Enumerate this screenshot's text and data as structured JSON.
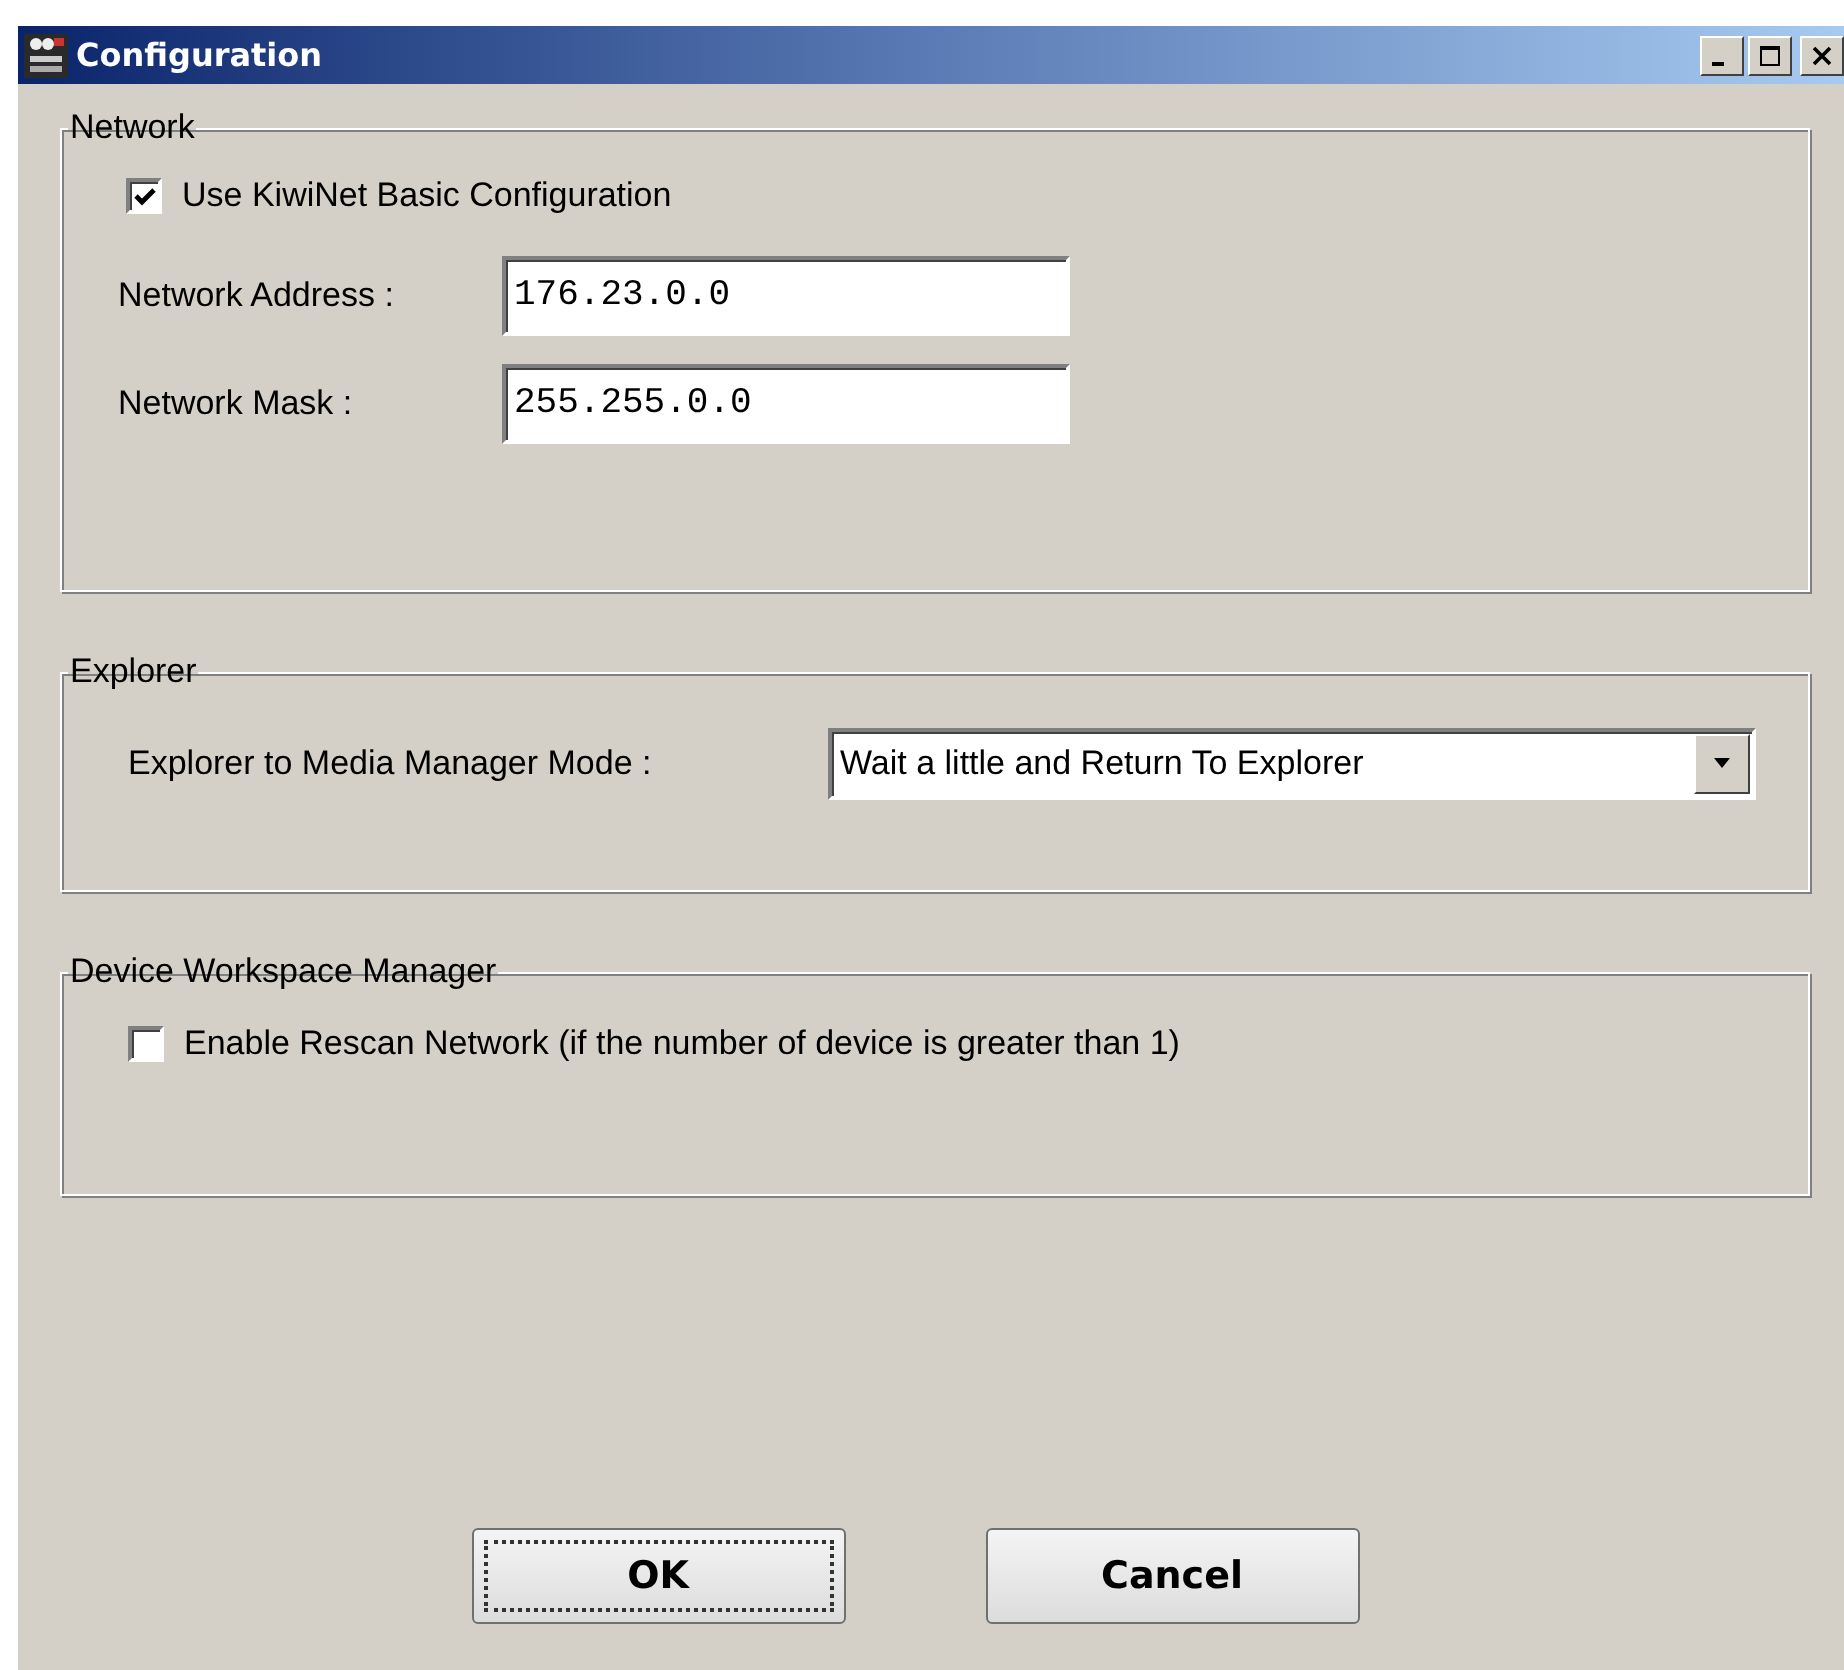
{
  "window": {
    "title": "Configuration"
  },
  "network": {
    "legend": "Network",
    "basic": {
      "label": "Use KiwiNet Basic Configuration",
      "checked": true
    },
    "fields": [
      {
        "label": "Network Address :",
        "value": "176.23.0.0"
      },
      {
        "label": "Network Mask :",
        "value": "255.255.0.0"
      }
    ]
  },
  "explorer": {
    "legend": "Explorer",
    "label": "Explorer to Media Manager Mode :",
    "value": "Wait a little and Return To Explorer"
  },
  "device": {
    "legend": "Device Workspace Manager",
    "rescan": {
      "label": "Enable Rescan Network (if the number of device is greater than 1)",
      "checked": false
    }
  },
  "buttons": [
    {
      "label": "OK",
      "default": true
    },
    {
      "label": "Cancel",
      "default": false
    }
  ]
}
